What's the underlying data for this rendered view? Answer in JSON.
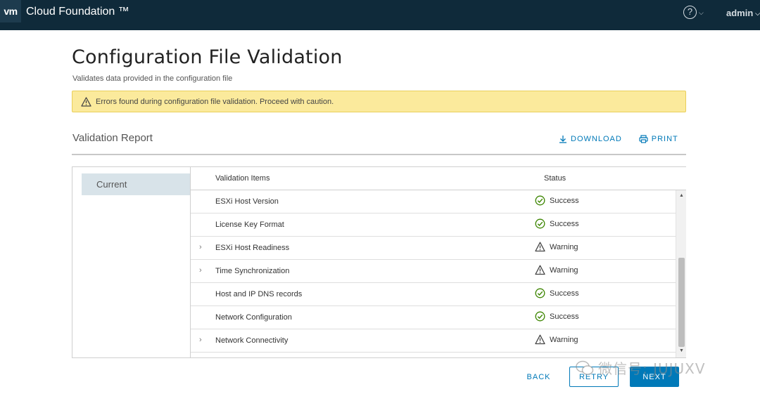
{
  "header": {
    "logo_text": "vm",
    "title": "Cloud Foundation ™",
    "help_icon": "?",
    "user": "admin",
    "bg_color": "#0f2a3a"
  },
  "page": {
    "title": "Configuration File Validation",
    "subtitle": "Validates data provided in the configuration file"
  },
  "alert": {
    "icon": "warning-triangle-icon",
    "text": "Errors found during configuration file validation. Proceed with caution.",
    "bg_color": "#fbea9c"
  },
  "report": {
    "title": "Validation Report",
    "download_label": "DOWNLOAD",
    "print_label": "PRINT"
  },
  "sidebar": {
    "tabs": [
      {
        "label": "Current",
        "selected": true
      }
    ]
  },
  "table": {
    "columns": [
      "Validation Items",
      "Status"
    ],
    "rows": [
      {
        "item": "ESXi Host Version",
        "status": "Success",
        "expandable": false
      },
      {
        "item": "License Key Format",
        "status": "Success",
        "expandable": false
      },
      {
        "item": "ESXi Host Readiness",
        "status": "Warning",
        "expandable": true
      },
      {
        "item": "Time Synchronization",
        "status": "Warning",
        "expandable": true
      },
      {
        "item": "Host and IP DNS records",
        "status": "Success",
        "expandable": false
      },
      {
        "item": "Network Configuration",
        "status": "Success",
        "expandable": false
      },
      {
        "item": "Network Connectivity",
        "status": "Warning",
        "expandable": true
      }
    ],
    "status_colors": {
      "Success": "#3c8500",
      "Warning": "#444444"
    }
  },
  "footer": {
    "back_label": "BACK",
    "retry_label": "RETRY",
    "next_label": "NEXT"
  },
  "watermark": {
    "text": "微信号: JUJUXV"
  },
  "accent_color": "#0079b8"
}
